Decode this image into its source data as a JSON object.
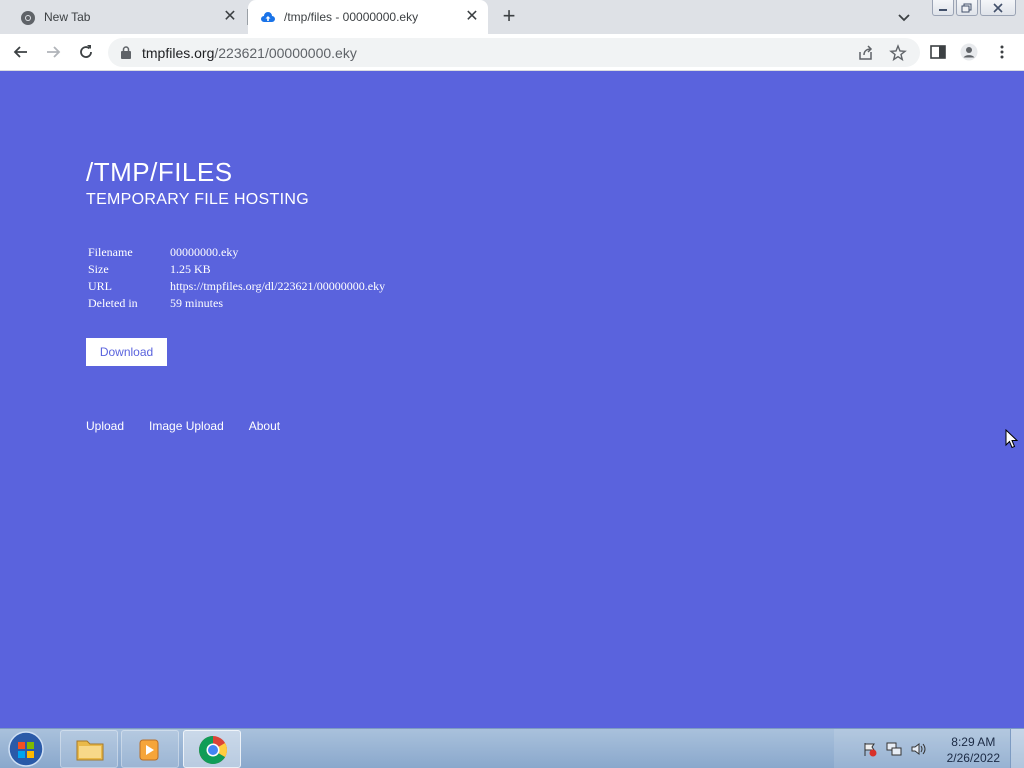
{
  "browser": {
    "tabs": [
      {
        "title": "New Tab",
        "active": false
      },
      {
        "title": "/tmp/files - 00000000.eky",
        "active": true
      }
    ],
    "address": {
      "domain": "tmpfiles.org",
      "path": "/223621/00000000.eky"
    }
  },
  "page": {
    "title": "/TMP/FILES",
    "subtitle": "TEMPORARY FILE HOSTING",
    "file_info": [
      {
        "label": "Filename",
        "value": "00000000.eky"
      },
      {
        "label": "Size",
        "value": "1.25 KB"
      },
      {
        "label": "URL",
        "value": "https://tmpfiles.org/dl/223621/00000000.eky"
      },
      {
        "label": "Deleted in",
        "value": "59 minutes"
      }
    ],
    "download_label": "Download",
    "footer_links": [
      "Upload",
      "Image Upload",
      "About"
    ],
    "background_color": "#5a63dd"
  },
  "taskbar": {
    "time": "8:29 AM",
    "date": "2/26/2022"
  }
}
